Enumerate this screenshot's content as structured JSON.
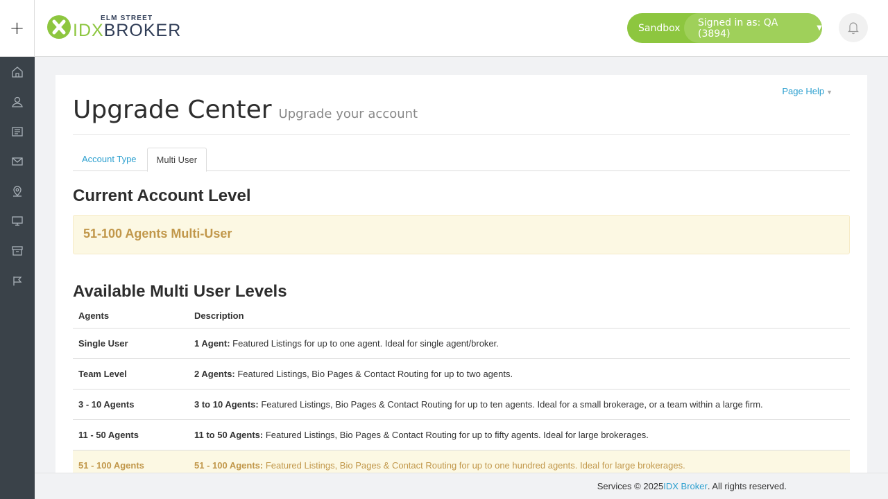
{
  "header": {
    "plus_glyph": "+",
    "logo_small": "ELM STREET",
    "logo_idx": "IDX",
    "logo_broker": "BROKER",
    "environment": "Sandbox",
    "signed_in_label": "Signed in as: QA (3894)"
  },
  "sidebar": {
    "items": [
      {
        "icon": "home-icon"
      },
      {
        "icon": "user-icon"
      },
      {
        "icon": "listings-icon"
      },
      {
        "icon": "mail-icon"
      },
      {
        "icon": "map-pin-icon"
      },
      {
        "icon": "monitor-icon"
      },
      {
        "icon": "archive-icon"
      },
      {
        "icon": "flag-icon"
      }
    ]
  },
  "page": {
    "help_label": "Page Help",
    "title": "Upgrade Center",
    "subtitle": "Upgrade your account"
  },
  "tabs": [
    {
      "label": "Account Type",
      "active": false
    },
    {
      "label": "Multi User",
      "active": true
    }
  ],
  "current": {
    "heading": "Current Account Level",
    "level": "51-100 Agents Multi-User"
  },
  "available": {
    "heading": "Available Multi User Levels",
    "columns": [
      "Agents",
      "Description"
    ],
    "rows": [
      {
        "agents": "Single User",
        "desc_bold": "1 Agent:",
        "desc": " Featured Listings for up to one agent. Ideal for single agent/broker."
      },
      {
        "agents": "Team Level",
        "desc_bold": "2 Agents:",
        "desc": " Featured Listings, Bio Pages & Contact Routing for up to two agents."
      },
      {
        "agents": "3 - 10 Agents",
        "desc_bold": "3 to 10 Agents:",
        "desc": " Featured Listings, Bio Pages & Contact Routing for up to ten agents. Ideal for a small brokerage, or a team within a large firm."
      },
      {
        "agents": "11 - 50 Agents",
        "desc_bold": "11 to 50 Agents:",
        "desc": " Featured Listings, Bio Pages & Contact Routing for up to fifty agents. Ideal for large brokerages."
      },
      {
        "agents": "51 - 100 Agents",
        "desc_bold": "51 - 100 Agents:",
        "desc": " Featured Listings, Bio Pages & Contact Routing for up to one hundred agents. Ideal for large brokerages."
      }
    ]
  },
  "footer": {
    "prefix": "Services © 2025 ",
    "link": "IDX Broker",
    "suffix": ". All rights reserved."
  },
  "colors": {
    "brand_green": "#8dc63f",
    "sidebar": "#3a4249",
    "link_blue": "#2b9fcf",
    "highlight_bg": "#fcf8e3",
    "highlight_text": "#c1974a"
  }
}
